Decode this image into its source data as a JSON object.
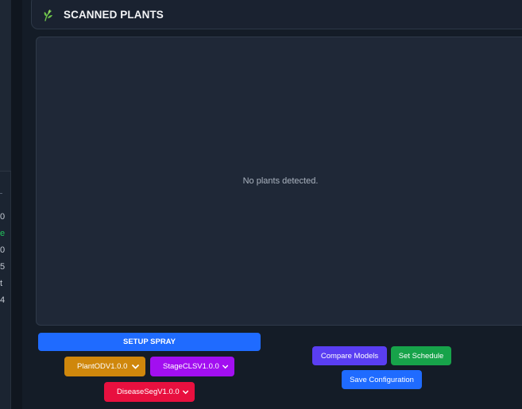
{
  "sidebar": {
    "stats": [
      {
        "text": "0",
        "color": "#c3c9d2"
      },
      {
        "text": "e",
        "color": "#22c55e"
      },
      {
        "text": "0",
        "color": "#c3c9d2"
      },
      {
        "text": "5",
        "color": "#c3c9d2"
      },
      {
        "text": "t",
        "color": "#c3c9d2"
      },
      {
        "text": "4",
        "color": "#c3c9d2"
      }
    ]
  },
  "header": {
    "title": "SCANNED PLANTS",
    "icon": "leaf-icon"
  },
  "plants": {
    "empty_message": "No plants detected."
  },
  "actions": {
    "setup_spray": "SETUP SPRAY",
    "compare_models": "Compare Models",
    "set_schedule": "Set Schedule",
    "save_configuration": "Save Configuration"
  },
  "models": {
    "plant_od": "PlantODV1.0.0",
    "stage_cls": "StageCLSV1.0.0",
    "disease_seg": "DiseaseSegV1.0.0"
  },
  "colors": {
    "primary": "#1f6bff",
    "plant_od": "#cf870c",
    "stage_cls": "#a20ff0",
    "disease_seg": "#e8103f",
    "compare": "#5a3ef2",
    "schedule": "#17a34a",
    "accent_green": "#22c55e"
  }
}
